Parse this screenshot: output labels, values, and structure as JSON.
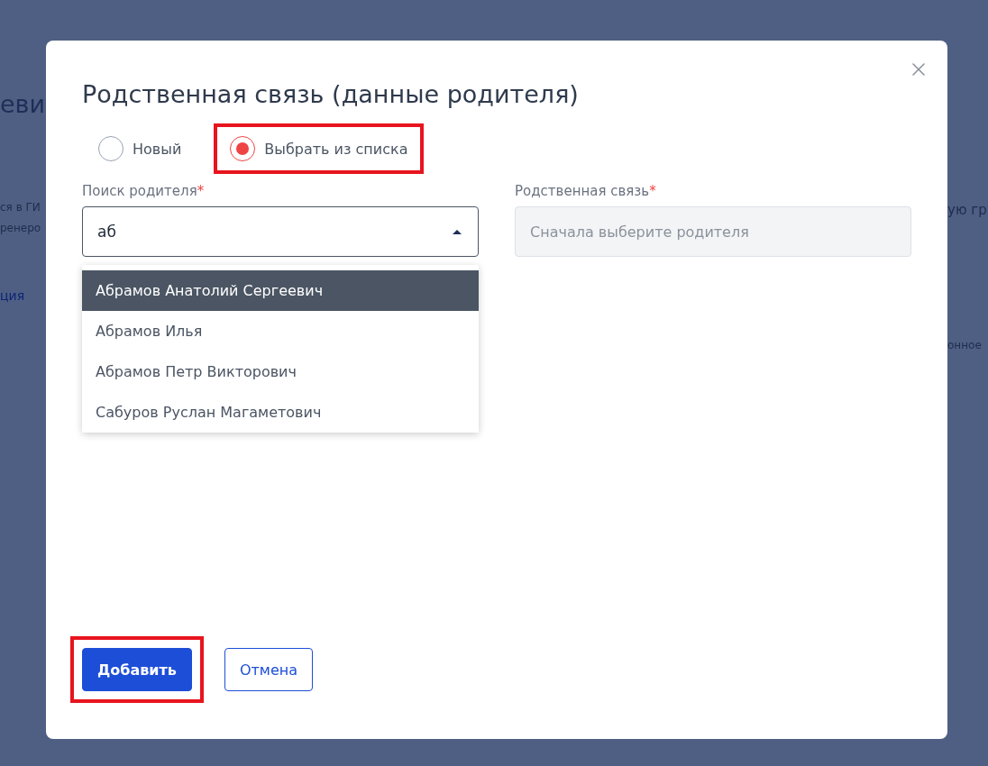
{
  "background": {
    "title_fragment": "еви",
    "lines_left": [
      "ся в ГИ",
      "ренеро"
    ],
    "link_fragment": "ция",
    "lines_right": [
      "ую гр",
      "онное"
    ]
  },
  "dialog": {
    "title": "Родственная связь (данные родителя)",
    "mode_options": [
      {
        "label": "Новый",
        "selected": false,
        "highlighted": false
      },
      {
        "label": "Выбрать из списка",
        "selected": true,
        "highlighted": true
      }
    ],
    "fields": [
      {
        "kind": "combobox",
        "label": "Поиск родителя",
        "required_mark": "*",
        "value": "аб",
        "expanded": true
      },
      {
        "kind": "select",
        "label": "Родственная связь",
        "required_mark": "*",
        "placeholder": "Сначала выберите родителя",
        "disabled": true
      }
    ],
    "suggestions": [
      {
        "label": "Абрамов Анатолий Сергеевич",
        "selected": true
      },
      {
        "label": "Абрамов Илья",
        "selected": false
      },
      {
        "label": "Абрамов Петр Викторович",
        "selected": false
      },
      {
        "label": "Сабуров Руслан Магаметович",
        "selected": false
      }
    ],
    "buttons": [
      {
        "kind": "primary",
        "label": "Добавить",
        "highlighted": true
      },
      {
        "kind": "secondary",
        "label": "Отмена",
        "highlighted": false
      }
    ]
  }
}
